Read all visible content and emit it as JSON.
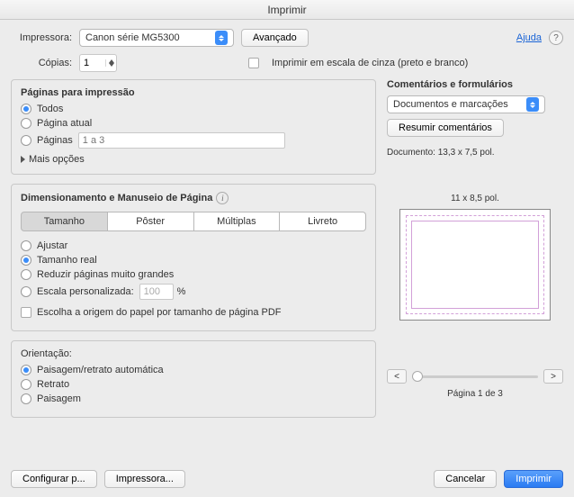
{
  "title": "Imprimir",
  "printer": {
    "label": "Impressora:",
    "value": "Canon série MG5300",
    "advanced": "Avançado"
  },
  "help": "Ajuda",
  "copies": {
    "label": "Cópias:",
    "value": "1"
  },
  "grayscale_label": "Imprimir em escala de cinza (preto e branco)",
  "pages_panel": {
    "title": "Páginas para impressão",
    "all": "Todos",
    "current": "Página atual",
    "pages": "Páginas",
    "pages_placeholder": "1 a 3",
    "more": "Mais opções"
  },
  "sizing_panel": {
    "title": "Dimensionamento e Manuseio de Página",
    "tabs": {
      "size": "Tamanho",
      "poster": "Pôster",
      "multiple": "Múltiplas",
      "booklet": "Livreto"
    },
    "fit": "Ajustar",
    "actual": "Tamanho real",
    "shrink": "Reduzir páginas muito grandes",
    "custom": "Escala personalizada:",
    "custom_value": "100",
    "percent": "%",
    "paper_source": "Escolha a origem do papel por tamanho de página PDF"
  },
  "orientation_panel": {
    "title": "Orientação:",
    "auto": "Paisagem/retrato automática",
    "portrait": "Retrato",
    "landscape": "Paisagem"
  },
  "comments_panel": {
    "title": "Comentários e formulários",
    "value": "Documentos e marcações",
    "summarize": "Resumir comentários"
  },
  "doc_dims": "Documento: 13,3 x 7,5 pol.",
  "preview_dims": "11 x 8,5 pol.",
  "nav": {
    "prev": "<",
    "next": ">"
  },
  "page_of": "Página 1 de 3",
  "footer": {
    "page_setup": "Configurar p...",
    "printer_btn": "Impressora...",
    "cancel": "Cancelar",
    "print": "Imprimir"
  }
}
